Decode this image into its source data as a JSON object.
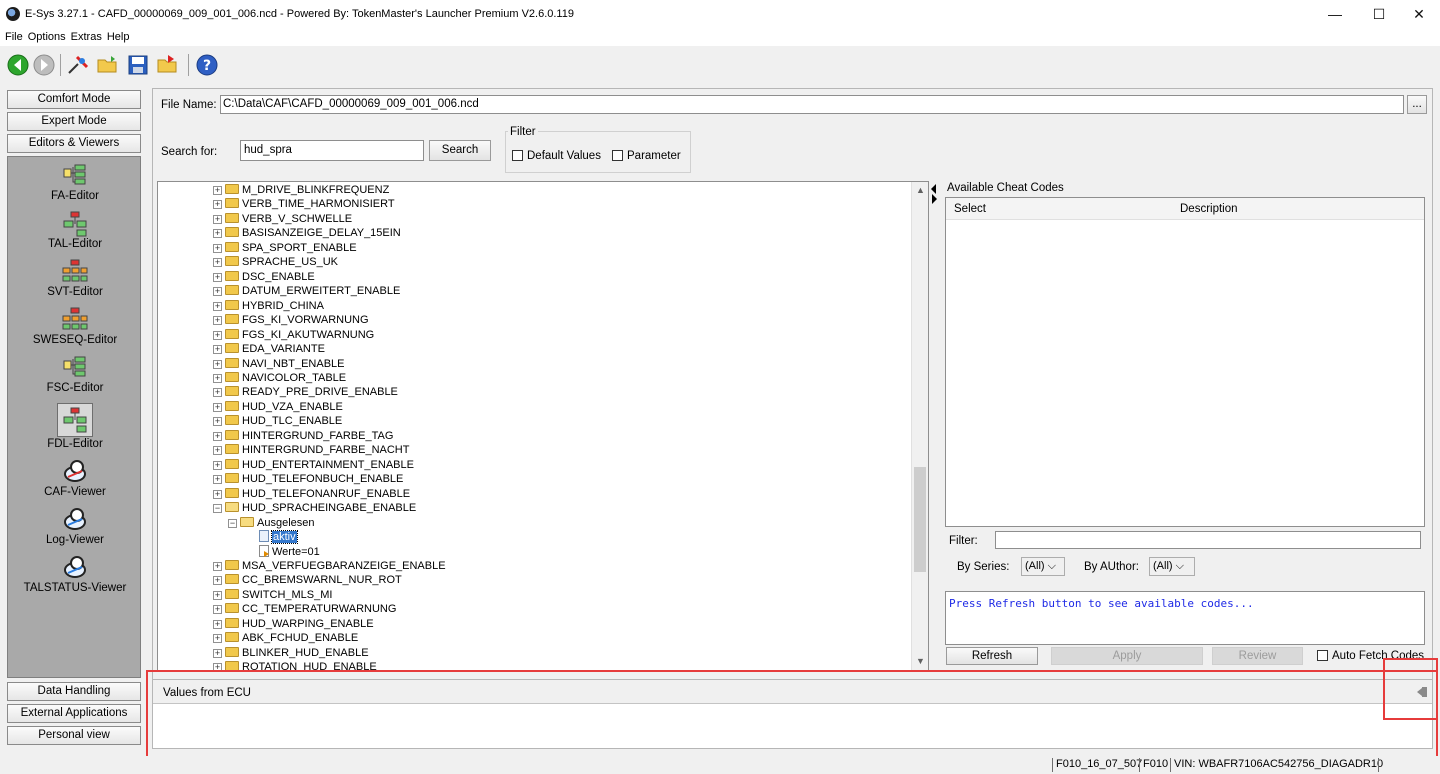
{
  "window": {
    "title": "E-Sys 3.27.1 - CAFD_00000069_009_001_006.ncd   - Powered By: TokenMaster's Launcher Premium V2.6.0.119",
    "controls": {
      "minimize": "—",
      "maximize": "☐",
      "close": "✕"
    }
  },
  "menu": [
    "File",
    "Options",
    "Extras",
    "Help"
  ],
  "toolbar": {
    "icons": [
      "back-arrow-icon",
      "forward-arrow-icon",
      "connect-icon",
      "open-folder-icon",
      "save-icon",
      "export-folder-icon",
      "help-icon"
    ]
  },
  "sidebar": {
    "top_buttons": [
      "Comfort Mode",
      "Expert Mode",
      "Editors & Viewers"
    ],
    "tools": [
      "FA-Editor",
      "TAL-Editor",
      "SVT-Editor",
      "SWESEQ-Editor",
      "FSC-Editor",
      "FDL-Editor",
      "CAF-Viewer",
      "Log-Viewer",
      "TALSTATUS-Viewer"
    ],
    "active_tool": "FDL-Editor",
    "bottom_buttons": [
      "Data Handling",
      "External Applications",
      "Personal view"
    ]
  },
  "file": {
    "label": "File Name:",
    "value": "C:\\Data\\CAF\\CAFD_00000069_009_001_006.ncd",
    "browse": "..."
  },
  "search": {
    "label": "Search for:",
    "value": "hud_spra",
    "button": "Search"
  },
  "filter": {
    "title": "Filter",
    "default_values": "Default Values",
    "parameter": "Parameter"
  },
  "tree": {
    "items_before": [
      "M_DRIVE_BLINKFREQUENZ",
      "VERB_TIME_HARMONISIERT",
      "VERB_V_SCHWELLE",
      "BASISANZEIGE_DELAY_15EIN",
      "SPA_SPORT_ENABLE",
      "SPRACHE_US_UK",
      "DSC_ENABLE",
      "DATUM_ERWEITERT_ENABLE",
      "HYBRID_CHINA",
      "FGS_KI_VORWARNUNG",
      "FGS_KI_AKUTWARNUNG",
      "EDA_VARIANTE",
      "NAVI_NBT_ENABLE",
      "NAVICOLOR_TABLE",
      "READY_PRE_DRIVE_ENABLE",
      "HUD_VZA_ENABLE",
      "HUD_TLC_ENABLE",
      "HINTERGRUND_FARBE_TAG",
      "HINTERGRUND_FARBE_NACHT",
      "HUD_ENTERTAINMENT_ENABLE",
      "HUD_TELEFONBUCH_ENABLE",
      "HUD_TELEFONANRUF_ENABLE"
    ],
    "expanded": "HUD_SPRACHEINGABE_ENABLE",
    "child": "Ausgelesen",
    "leaf_selected": "aktiv",
    "leaf_value": "Werte=01",
    "items_after": [
      "MSA_VERFUEGBARANZEIGE_ENABLE",
      "CC_BREMSWARNL_NUR_ROT",
      "SWITCH_MLS_MI",
      "CC_TEMPERATURWARNUNG",
      "HUD_WARPING_ENABLE",
      "ABK_FCHUD_ENABLE",
      "BLINKER_HUD_ENABLE",
      "ROTATION_HUD_ENABLE"
    ]
  },
  "cheat": {
    "title": "Available Cheat Codes",
    "columns": [
      "Select",
      "Description"
    ],
    "filter_label": "Filter:",
    "filter_value": "",
    "by_series_label": "By Series:",
    "by_series_value": "(All)",
    "by_author_label": "By AUthor:",
    "by_author_value": "(All)",
    "console_text": "Press Refresh button to see available codes...",
    "refresh": "Refresh",
    "apply": "Apply",
    "review": "Review",
    "auto_fetch": "Auto Fetch Codes"
  },
  "values_panel": {
    "title": "Values from ECU"
  },
  "status": {
    "seg1": "F010_16_07_507",
    "seg2": "F010",
    "seg3": "VIN: WBAFR7106AC542756_DIAGADR10"
  },
  "colors": {
    "highlight_red": "#e63b3b",
    "selection_blue": "#3377cc",
    "console_blue": "#1f2ae6"
  }
}
